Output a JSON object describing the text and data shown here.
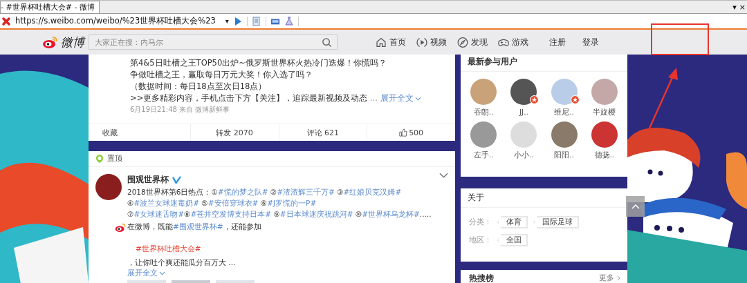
{
  "browser": {
    "tab_title": "- #世界杯吐槽大会# - 微博",
    "tab_menu": "▾",
    "tab_close": "×",
    "url": "https://s.weibo.com/weibo/%23世界杯吐槽大会%23",
    "url_menu": "▾"
  },
  "header": {
    "logo_text": "微博",
    "search_placeholder": "大家正在搜：内马尔",
    "nav": [
      {
        "kind": "home",
        "label": "首页"
      },
      {
        "kind": "video",
        "label": "视频"
      },
      {
        "kind": "discover",
        "label": "发现"
      },
      {
        "kind": "game",
        "label": "游戏"
      },
      {
        "kind": "plain",
        "label": "注册"
      },
      {
        "kind": "plain",
        "label": "登录"
      }
    ]
  },
  "post_1": {
    "lines": [
      "第4&5日吐槽之王TOP50出炉~俄罗斯世界杯火热冷门迭爆！你慌吗？",
      "争做吐槽之王，赢取每日万元大奖！你入选了吗？",
      "（数据时间：每日18点至次日18点）",
      ">>更多精彩内容，手机点击下方【关注】，追踪最新视频及动态"
    ],
    "ellipsis": "...",
    "expand": "展开全文",
    "meta": {
      "time": "6月19日21:48",
      "from": "来自",
      "source": "微博新鲜事"
    },
    "actions": [
      {
        "kind": "favorite",
        "label": "收藏"
      },
      {
        "kind": "repost",
        "label": "转发 2070"
      },
      {
        "kind": "comment",
        "label": "评论 621"
      },
      {
        "kind": "like",
        "label": "500"
      }
    ]
  },
  "post_2": {
    "pinned": "置顶",
    "author": "围观世界杯",
    "verified": true,
    "segments": [
      {
        "kind": "text",
        "text": "2018世界杯第6日热点：①"
      },
      {
        "kind": "link",
        "text": "#慌的梦之队#"
      },
      {
        "kind": "text",
        "text": " ②"
      },
      {
        "kind": "link",
        "text": "#渣渣辉三千万#"
      },
      {
        "kind": "text",
        "text": " ③"
      },
      {
        "kind": "link",
        "text": "#红娘贝克汉姆#"
      },
      {
        "kind": "text",
        "text": " ④"
      },
      {
        "kind": "link",
        "text": "#波兰女球迷毒奶#"
      },
      {
        "kind": "text",
        "text": " ⑤"
      },
      {
        "kind": "link",
        "text": "#安倍穿球衣#"
      },
      {
        "kind": "text",
        "text": " ⑥"
      },
      {
        "kind": "link",
        "text": "#J罗慌的一P#"
      },
      {
        "kind": "text",
        "text": " ⑦"
      },
      {
        "kind": "link",
        "text": "#女球迷舌吻#"
      },
      {
        "kind": "text",
        "text": "⑧"
      },
      {
        "kind": "link",
        "text": "#苍井空发博支持日本#"
      },
      {
        "kind": "text",
        "text": " ⑨"
      },
      {
        "kind": "link",
        "text": "#日本球迷庆祝跳河#"
      },
      {
        "kind": "text",
        "text": " ⑩"
      },
      {
        "kind": "link",
        "text": "#世界杯乌龙杯#"
      },
      {
        "kind": "text",
        "text": "....."
      }
    ],
    "promo": [
      {
        "kind": "text",
        "text": "在微博，既能"
      },
      {
        "kind": "link",
        "text": "#围观世界杯#"
      },
      {
        "kind": "text",
        "text": "，还能参加"
      },
      {
        "kind": "hot",
        "text": "#世界杯吐槽大会#"
      },
      {
        "kind": "text",
        "text": "，让你吐个爽还能瓜分百万大 ..."
      }
    ],
    "expand": "展开全文"
  },
  "sidebar": {
    "users": {
      "title": "最新参与用户",
      "items": [
        {
          "name": "吞朗..",
          "verified": false
        },
        {
          "name": "JJ..",
          "verified": true
        },
        {
          "name": "维尼..",
          "verified": true
        },
        {
          "name": "半旋樱",
          "verified": false
        },
        {
          "name": "左手..",
          "verified": false
        },
        {
          "name": "小小..",
          "verified": false
        },
        {
          "name": "阳阳..",
          "verified": false
        },
        {
          "name": "德扬..",
          "verified": false
        }
      ]
    },
    "about": {
      "title": "关于",
      "rows": [
        {
          "label": "分类：",
          "tags": [
            "体育",
            "国际足球"
          ]
        },
        {
          "label": "地区：",
          "tags": [
            "全国"
          ]
        }
      ]
    },
    "hot": {
      "title": "热搜榜",
      "more": "更多"
    }
  }
}
